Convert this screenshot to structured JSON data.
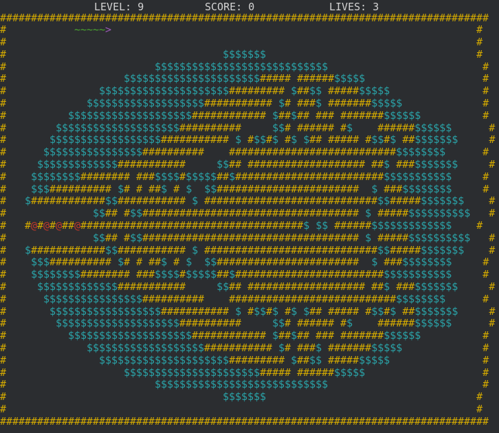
{
  "hud": {
    "level": "LEVEL: 9",
    "score": "SCORE: 0",
    "lives": "LIVES: 3"
  },
  "board": {
    "rows": [
      "###############################################################################",
      "#           ~~~~~>                                                           #",
      "#                                                                            #",
      "#                                   $$$$$$$                                  #",
      "#                        $$$$$$$$$$$$$$$$$$$$$$$$$$$$                         #",
      "#                   $$$$$$$$$$$$$$$$$$$$$$##### ######$$$$$                   #",
      "#               $$$$$$$$$$$$$$$$$$$$$######### $##$$ #####$$$$$               #",
      "#             $$$$$$$$$$$$$$$$$$$########### $# ###$ #######$$$$$             #",
      "#          $$$$$$$$$$$$$$$$$$$$############ $##$## ### #######$$$$$$          #",
      "#        $$$$$$$$$$$$$$$$$$$$##########     $$# ###### #$    ######$$$$$$      #",
      "#       $$$$$$$$$$$$$$$$$$########### $ #$$#$ #$ $## ##### #$$#$ ##$$$$$$$     #",
      "#      $$$$$$$$$$$$$$$$##########    ###########################$$$$$$$$      #",
      "#     $$$$$$$$$$$$$###########     $$## ################### ##$ ###$$$$$$$     #",
      "#    $$$$$$$$######## ###$$$$#$$$$$##$########################$$$$$$$$$$$     #",
      "#    $$$########## $# # ##$ # $  $$#######################  $ ###$$$$$$$$     #",
      "#   $############$$########### $ ############################$$#####$$$$$$$    #",
      "#              $$## #$$################################### $ #####$$$$$$$$$$   #",
      "#   #@#@#@##@####################################$ $$ ######$$$$$$$$$$$$$    #",
      "#              $$## #$$################################### $ #####$$$$$$$$$$   #",
      "#   $############$$########### $ ############################$$#####$$$$$$$    #",
      "#    $$$########## $# # ##$ # $  $$#######################  $ ###$$$$$$$$     #",
      "#    $$$$$$$$######## ###$$$$#$$$$$##$########################$$$$$$$$$$$     #",
      "#     $$$$$$$$$$$$$###########     $$## ################### ##$ ###$$$$$$$     #",
      "#      $$$$$$$$$$$$$$$$##########    ###########################$$$$$$$$      #",
      "#       $$$$$$$$$$$$$$$$$$########### $ #$$#$ #$ $## ##### #$$#$ ##$$$$$$$     #",
      "#        $$$$$$$$$$$$$$$$$$$$##########     $$# ###### #$    ######$$$$$$      #",
      "#          $$$$$$$$$$$$$$$$$$$$############ $##$## ### #######$$$$$$          #",
      "#             $$$$$$$$$$$$$$$$$$$########### $# ###$ #######$$$$$             #",
      "#               $$$$$$$$$$$$$$$$$$$$$######### $##$$ #####$$$$$               #",
      "#                   $$$$$$$$$$$$$$$$$$$$$$##### ######$$$$$                   #",
      "#                        $$$$$$$$$$$$$$$$$$$$$$$$$$$$                         #",
      "#                                   $$$$$$$                                  #",
      "#                                                                            #",
      "###############################################################################"
    ]
  },
  "colors": {
    "background": "#2b2d30",
    "wall": "#d4aa00",
    "coin": "#2aa3a8",
    "snake_tail": "#4aa52f",
    "snake_head": "#9b59b6",
    "enemy": "#c0392b",
    "hud_text": "#d4d4d4"
  }
}
